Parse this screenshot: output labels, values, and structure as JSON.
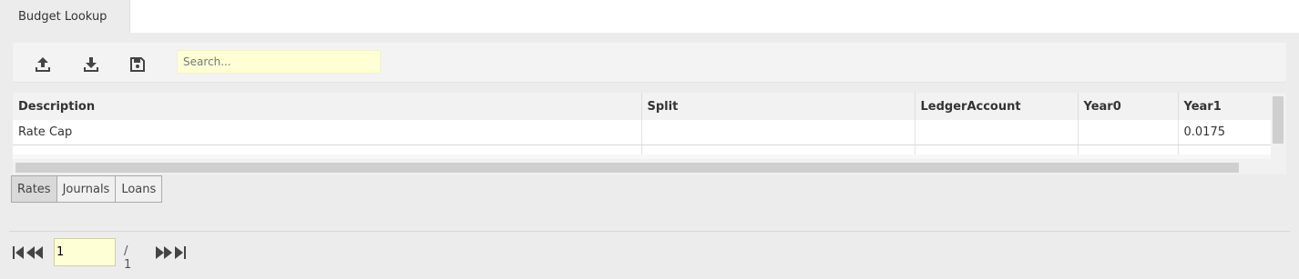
{
  "tabs": [
    {
      "label": "Budget Lookup",
      "active": true
    }
  ],
  "toolbar": {
    "upload_icon": "upload-icon",
    "download_icon": "download-icon",
    "save_icon": "save-icon",
    "search_placeholder": "Search..."
  },
  "grid": {
    "columns": [
      "Description",
      "Split",
      "LedgerAccount",
      "Year0",
      "Year1"
    ],
    "rows": [
      [
        "Rate Cap",
        "",
        "",
        "",
        "0.0175"
      ]
    ]
  },
  "subtabs": [
    {
      "label": "Rates",
      "active": true
    },
    {
      "label": "Journals",
      "active": false
    },
    {
      "label": "Loans",
      "active": false
    }
  ],
  "pager": {
    "page_value": "1",
    "total_label": "/ 1",
    "first_icon": "first-page-icon",
    "prev_icon": "prev-page-icon",
    "next_icon": "next-page-icon",
    "last_icon": "last-page-icon"
  },
  "colors": {
    "background": "#ececec",
    "input_highlight": "#ffffd6",
    "icon": "#444444"
  }
}
